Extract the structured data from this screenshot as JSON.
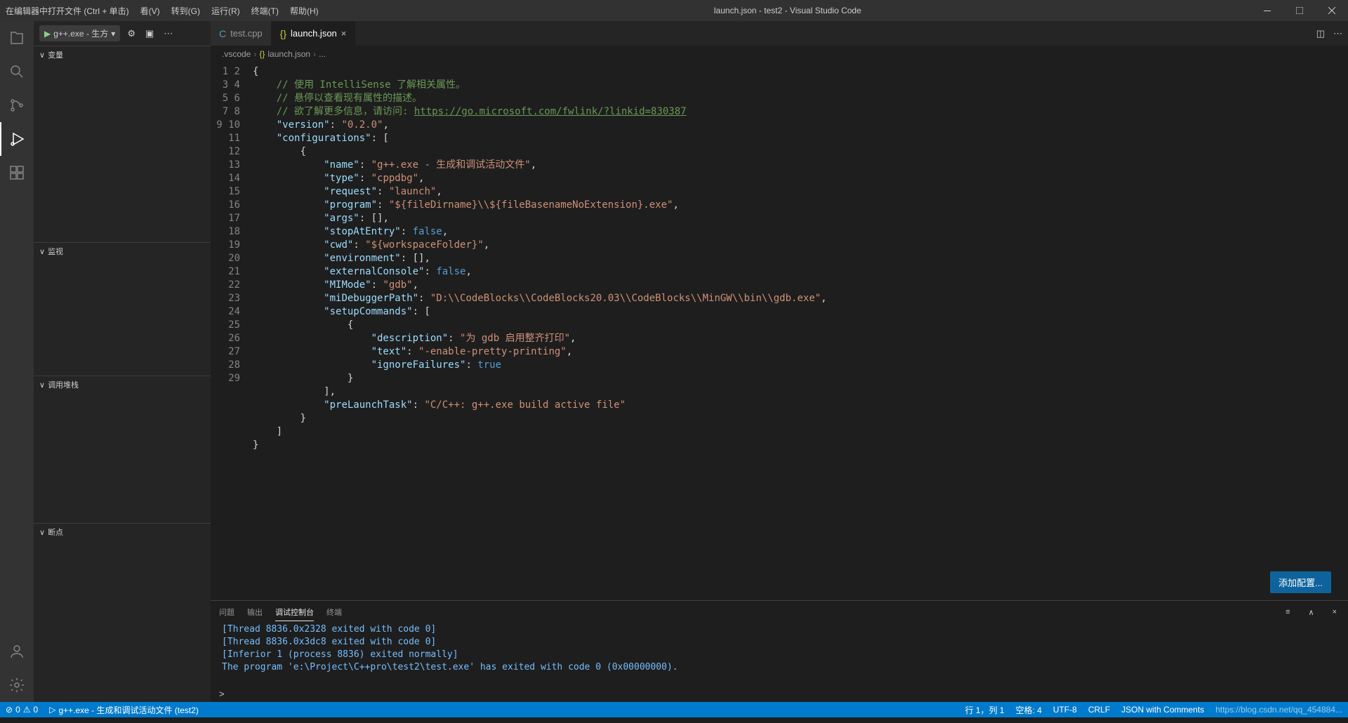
{
  "titlebar": {
    "tip": "在编辑器中打开文件 (Ctrl + 单击)",
    "menus": [
      "看(V)",
      "转到(G)",
      "运行(R)",
      "终端(T)",
      "帮助(H)"
    ],
    "title": "launch.json - test2 - Visual Studio Code"
  },
  "debugToolbar": {
    "run_label": "g++.exe - 生方"
  },
  "sidebar": {
    "variables": "变量",
    "watch": "监视",
    "callstack": "调用堆栈",
    "breakpoints": "断点"
  },
  "tabs": [
    {
      "name": "test.cpp",
      "icon_color": "#519aba",
      "active": false
    },
    {
      "name": "launch.json",
      "icon_color": "#cbcb41",
      "active": true
    }
  ],
  "breadcrumbs": [
    ".vscode",
    "launch.json",
    "..."
  ],
  "code": {
    "lines": 29,
    "comment1": "// 使用 IntelliSense 了解相关属性。",
    "comment2": "// 悬停以查看现有属性的描述。",
    "comment3_pre": "// 欲了解更多信息，请访问: ",
    "comment3_url": "https://go.microsoft.com/fwlink/?linkid=830387",
    "k_version": "\"version\"",
    "v_version": "\"0.2.0\"",
    "k_configs": "\"configurations\"",
    "k_name": "\"name\"",
    "v_name": "\"g++.exe - 生成和调试活动文件\"",
    "k_type": "\"type\"",
    "v_type": "\"cppdbg\"",
    "k_request": "\"request\"",
    "v_request": "\"launch\"",
    "k_program": "\"program\"",
    "v_program": "\"${fileDirname}\\\\${fileBasenameNoExtension}.exe\"",
    "k_args": "\"args\"",
    "k_stop": "\"stopAtEntry\"",
    "v_false": "false",
    "k_cwd": "\"cwd\"",
    "v_cwd": "\"${workspaceFolder}\"",
    "k_env": "\"environment\"",
    "k_extcon": "\"externalConsole\"",
    "k_mimode": "\"MIMode\"",
    "v_mimode": "\"gdb\"",
    "k_midbg": "\"miDebuggerPath\"",
    "v_midbg": "\"D:\\\\CodeBlocks\\\\CodeBlocks20.03\\\\CodeBlocks\\\\MinGW\\\\bin\\\\gdb.exe\"",
    "k_setup": "\"setupCommands\"",
    "k_desc": "\"description\"",
    "v_desc": "\"为 gdb 启用整齐打印\"",
    "k_text": "\"text\"",
    "v_text": "\"-enable-pretty-printing\"",
    "k_ignore": "\"ignoreFailures\"",
    "v_true": "true",
    "k_prelaunch": "\"preLaunchTask\"",
    "v_prelaunch": "\"C/C++: g++.exe build active file\""
  },
  "addConfigBtn": "添加配置...",
  "panel": {
    "tabs": [
      "问题",
      "输出",
      "调试控制台",
      "终端"
    ],
    "active": 2,
    "lines": [
      "[Thread 8836.0x2328 exited with code 0]",
      "[Thread 8836.0x3dc8 exited with code 0]",
      "[Inferior 1 (process 8836) exited normally]",
      "The program 'e:\\Project\\C++pro\\test2\\test.exe' has exited with code 0 (0x00000000)."
    ],
    "prompt": ">"
  },
  "statusbar": {
    "errors": "0",
    "warnings": "0",
    "task": "g++.exe - 生成和调试活动文件 (test2)",
    "pos": "行 1，列 1",
    "spaces": "空格: 4",
    "enc": "UTF-8",
    "eol": "CRLF",
    "lang": "JSON with Comments",
    "watermark": "https://blog.csdn.net/qq_454884..."
  }
}
